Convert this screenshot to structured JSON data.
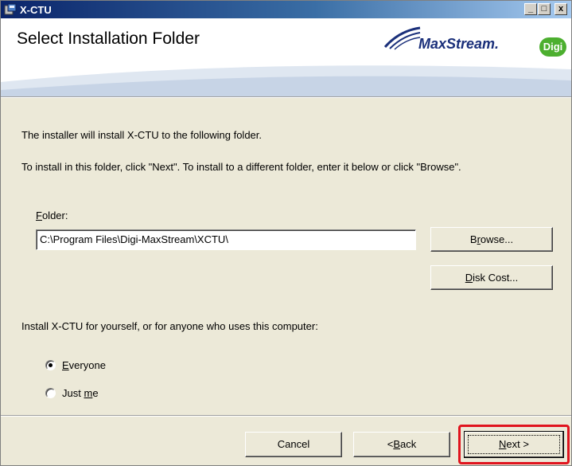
{
  "window": {
    "title": "X-CTU",
    "minimize_label": "_",
    "maximize_label": "□",
    "close_label": "x"
  },
  "banner": {
    "heading": "Select Installation Folder",
    "logo_text": "MaxStream.",
    "digi_text": "Digi"
  },
  "body": {
    "line1": "The installer will install X-CTU to the following folder.",
    "line2": "To install in this folder, click \"Next\". To install to a different folder, enter it below or click \"Browse\".",
    "folder_label_prefix": "",
    "folder_label_accel": "F",
    "folder_label_rest": "older:",
    "folder_value": "C:\\Program Files\\Digi-MaxStream\\XCTU\\",
    "browse_pre": "B",
    "browse_accel": "r",
    "browse_post": "owse...",
    "diskcost_accel": "D",
    "diskcost_post": "isk Cost...",
    "install_for": "Install X-CTU for yourself, or for anyone who uses this computer:",
    "radio_everyone_accel": "E",
    "radio_everyone_rest": "veryone",
    "radio_everyone_checked": true,
    "radio_justme_pre": "Just ",
    "radio_justme_accel": "m",
    "radio_justme_post": "e",
    "radio_justme_checked": false
  },
  "footer": {
    "cancel_label": "Cancel",
    "back_pre": "< ",
    "back_accel": "B",
    "back_post": "ack",
    "next_accel": "N",
    "next_post": "ext >"
  },
  "colors": {
    "highlight": "#e0141e",
    "title_bar": "#0a246a",
    "dialog_bg": "#ece9d8"
  },
  "icons": [
    "installer-app-icon",
    "minimize-icon",
    "maximize-icon",
    "close-icon",
    "maxstream-logo",
    "digi-logo"
  ]
}
